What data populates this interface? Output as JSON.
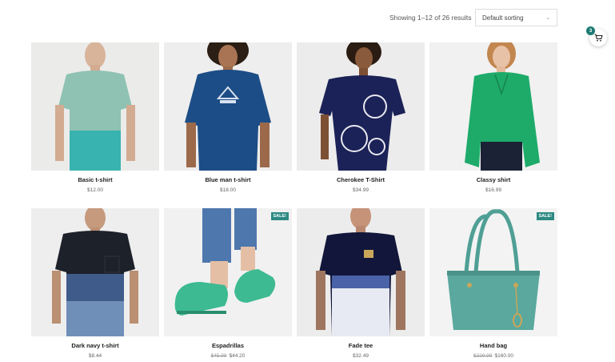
{
  "toolbar": {
    "result_count": "Showing 1–12 of 26 results",
    "sort_value": "Default sorting"
  },
  "cart": {
    "count": "3",
    "icon": "cart-icon"
  },
  "colors": {
    "accent": "#2c8a83"
  },
  "products": [
    {
      "name": "Basic t-shirt",
      "price": "$12.00"
    },
    {
      "name": "Blue man t-shirt",
      "price": "$18.00"
    },
    {
      "name": "Cherokee T-Shirt",
      "price": "$34.99"
    },
    {
      "name": "Classy shirt",
      "price": "$16.99"
    },
    {
      "name": "Dark navy t-shirt",
      "price": "$8.44"
    },
    {
      "name": "Espadrillas",
      "old_price": "$45.99",
      "price": "$44.20",
      "badge": "SALE!"
    },
    {
      "name": "Fade tee",
      "price": "$32.49"
    },
    {
      "name": "Hand bag",
      "old_price": "$229.99",
      "price": "$160.00",
      "badge": "SALE!"
    }
  ]
}
